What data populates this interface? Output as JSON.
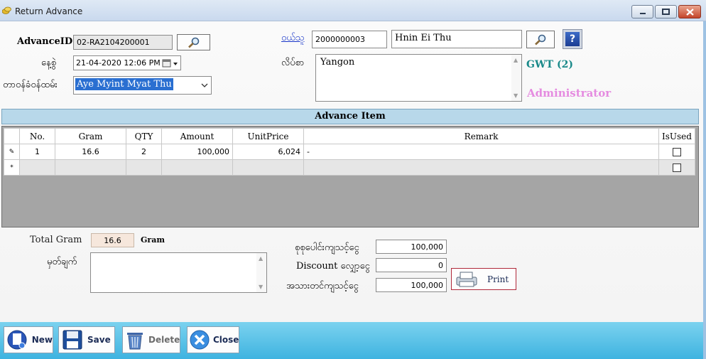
{
  "window": {
    "title": "Return Advance",
    "min_label": "",
    "max_label": "",
    "close_label": ""
  },
  "form": {
    "advance_id_label": "AdvanceID:",
    "advance_id_value": "02-RA2104200001",
    "date_label": "နေ့စွဲ",
    "date_value": "21-04-2020 12:06 PM",
    "staff_label": "တာဝန်ခံဝန်ထမ်း",
    "staff_value": "Aye Myint Myat Thu",
    "customer_label": "ဝယ်သူ",
    "customer_code": "2000000003",
    "customer_name": "Hnin Ei Thu",
    "address_label": "လိပ်စာ",
    "address_value": "Yangon",
    "gwt_text": "GWT (2)",
    "user_text": "Administrator"
  },
  "section": {
    "title": "Advance Item"
  },
  "grid": {
    "columns": [
      "No.",
      "Gram",
      "QTY",
      "Amount",
      "UnitPrice",
      "Remark",
      "IsUsed"
    ],
    "rows": [
      {
        "no": "1",
        "gram": "16.6",
        "qty": "2",
        "amount": "100,000",
        "unit_price": "6,024",
        "remark": "-",
        "is_used": false
      }
    ],
    "new_row_marker": "*",
    "edit_marker": "✎"
  },
  "summary": {
    "total_gram_label": "Total Gram",
    "total_gram_value": "16.6",
    "gram_unit": "Gram",
    "note_label": "မှတ်ချက်",
    "note_value": "",
    "total_label": "စုစုပေါင်းကျသင့်ငွေ",
    "total_value": "100,000",
    "discount_label": "Discount လျှော့ငွေ",
    "discount_value": "0",
    "net_label": "အသားတင်ကျသင့်ငွေ",
    "net_value": "100,000",
    "print_label": "Print"
  },
  "toolbar": {
    "new_label": "New",
    "save_label": "Save",
    "delete_label": "Delete",
    "close_label": "Close"
  },
  "colors": {
    "teal_text": "#1a8a8a",
    "pink_text": "#e58be0",
    "toolbar_blue": "#3eb3e0",
    "header_blue": "#b8d8ea"
  }
}
